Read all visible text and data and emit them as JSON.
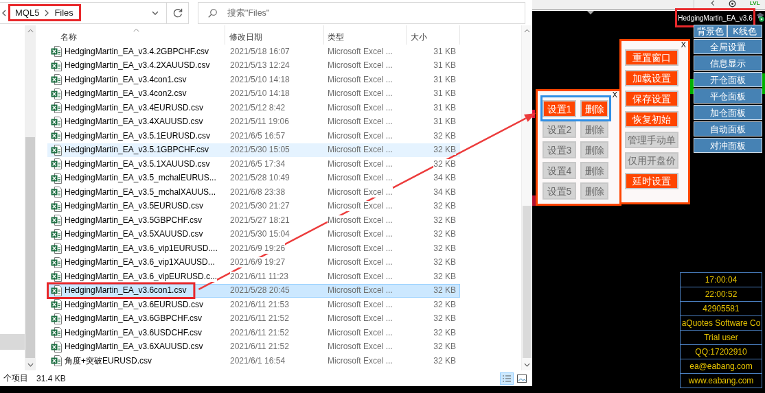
{
  "explorer": {
    "address_bar": {
      "path": [
        "MQL5",
        "Files"
      ],
      "outlined": true
    },
    "search": {
      "placeholder": "搜索\"Files\""
    },
    "columns": [
      {
        "label": "名称",
        "sorted": true
      },
      {
        "label": "修改日期",
        "sorted": false
      },
      {
        "label": "类型",
        "sorted": false
      },
      {
        "label": "大小",
        "sorted": false
      }
    ],
    "rows": [
      {
        "name": "HedgingMartin_EA_v3.4.2GBPCHF.csv",
        "modified": "2021/5/18 16:07",
        "type": "Microsoft Excel ...",
        "size": "31 KB",
        "selected": false,
        "hovered": false,
        "outlined": false
      },
      {
        "name": "HedgingMartin_EA_v3.4.2XAUUSD.csv",
        "modified": "2021/5/13 12:24",
        "type": "Microsoft Excel ...",
        "size": "31 KB",
        "selected": false,
        "hovered": false,
        "outlined": false
      },
      {
        "name": "HedgingMartin_EA_v3.4con1.csv",
        "modified": "2021/5/10 14:18",
        "type": "Microsoft Excel ...",
        "size": "31 KB",
        "selected": false,
        "hovered": false,
        "outlined": false
      },
      {
        "name": "HedgingMartin_EA_v3.4con2.csv",
        "modified": "2021/5/10 14:18",
        "type": "Microsoft Excel ...",
        "size": "31 KB",
        "selected": false,
        "hovered": false,
        "outlined": false
      },
      {
        "name": "HedgingMartin_EA_v3.4EURUSD.csv",
        "modified": "2021/5/12 8:42",
        "type": "Microsoft Excel ...",
        "size": "31 KB",
        "selected": false,
        "hovered": false,
        "outlined": false
      },
      {
        "name": "HedgingMartin_EA_v3.4XAUUSD.csv",
        "modified": "2021/5/11 19:06",
        "type": "Microsoft Excel ...",
        "size": "31 KB",
        "selected": false,
        "hovered": false,
        "outlined": false
      },
      {
        "name": "HedgingMartin_EA_v3.5.1EURUSD.csv",
        "modified": "2021/6/5 16:57",
        "type": "Microsoft Excel ...",
        "size": "32 KB",
        "selected": false,
        "hovered": false,
        "outlined": false
      },
      {
        "name": "HedgingMartin_EA_v3.5.1GBPCHF.csv",
        "modified": "2021/5/30 15:05",
        "type": "Microsoft Excel ...",
        "size": "32 KB",
        "selected": false,
        "hovered": true,
        "outlined": false
      },
      {
        "name": "HedgingMartin_EA_v3.5.1XAUUSD.csv",
        "modified": "2021/6/5 17:34",
        "type": "Microsoft Excel ...",
        "size": "32 KB",
        "selected": false,
        "hovered": false,
        "outlined": false
      },
      {
        "name": "HedgingMartin_EA_v3.5_mchalEURUS...",
        "modified": "2021/5/28 10:49",
        "type": "Microsoft Excel ...",
        "size": "34 KB",
        "selected": false,
        "hovered": false,
        "outlined": false
      },
      {
        "name": "HedgingMartin_EA_v3.5_mchalXAUUS...",
        "modified": "2021/6/8 23:38",
        "type": "Microsoft Excel ...",
        "size": "34 KB",
        "selected": false,
        "hovered": false,
        "outlined": false
      },
      {
        "name": "HedgingMartin_EA_v3.5EURUSD.csv",
        "modified": "2021/5/30 21:27",
        "type": "Microsoft Excel ...",
        "size": "32 KB",
        "selected": false,
        "hovered": false,
        "outlined": false
      },
      {
        "name": "HedgingMartin_EA_v3.5GBPCHF.csv",
        "modified": "2021/5/27 18:21",
        "type": "Microsoft Excel ...",
        "size": "32 KB",
        "selected": false,
        "hovered": false,
        "outlined": false
      },
      {
        "name": "HedgingMartin_EA_v3.5XAUUSD.csv",
        "modified": "2021/5/30 15:04",
        "type": "Microsoft Excel ...",
        "size": "32 KB",
        "selected": false,
        "hovered": false,
        "outlined": false
      },
      {
        "name": "HedgingMartin_EA_v3.6_vip1EURUSD....",
        "modified": "2021/6/9 19:26",
        "type": "Microsoft Excel ...",
        "size": "32 KB",
        "selected": false,
        "hovered": false,
        "outlined": false
      },
      {
        "name": "HedgingMartin_EA_v3.6_vip1XAUUSD...",
        "modified": "2021/6/9 19:27",
        "type": "Microsoft Excel ...",
        "size": "32 KB",
        "selected": false,
        "hovered": false,
        "outlined": false
      },
      {
        "name": "HedgingMartin_EA_v3.6_vipEURUSD.c...",
        "modified": "2021/6/11 11:23",
        "type": "Microsoft Excel ...",
        "size": "32 KB",
        "selected": false,
        "hovered": false,
        "outlined": false
      },
      {
        "name": "HedgingMartin_EA_v3.6con1.csv",
        "modified": "2021/5/28 20:45",
        "type": "Microsoft Excel ...",
        "size": "32 KB",
        "selected": true,
        "hovered": false,
        "outlined": true
      },
      {
        "name": "HedgingMartin_EA_v3.6EURUSD.csv",
        "modified": "2021/6/11 21:53",
        "type": "Microsoft Excel ...",
        "size": "32 KB",
        "selected": false,
        "hovered": false,
        "outlined": false
      },
      {
        "name": "HedgingMartin_EA_v3.6GBPCHF.csv",
        "modified": "2021/6/11 21:52",
        "type": "Microsoft Excel ...",
        "size": "32 KB",
        "selected": false,
        "hovered": false,
        "outlined": false
      },
      {
        "name": "HedgingMartin_EA_v3.6USDCHF.csv",
        "modified": "2021/6/11 21:52",
        "type": "Microsoft Excel ...",
        "size": "32 KB",
        "selected": false,
        "hovered": false,
        "outlined": false
      },
      {
        "name": "HedgingMartin_EA_v3.6XAUUSD.csv",
        "modified": "2021/6/11 21:52",
        "type": "Microsoft Excel ...",
        "size": "32 KB",
        "selected": false,
        "hovered": false,
        "outlined": false
      },
      {
        "name": "角度+突破EURUSD.csv",
        "modified": "2021/6/1 16:54",
        "type": "Microsoft Excel ...",
        "size": "32 KB",
        "selected": false,
        "hovered": false,
        "outlined": false
      }
    ],
    "status_bar": {
      "item_count": "个项目",
      "size": "31.4 KB",
      "views": [
        {
          "kind": "details",
          "selected": true
        },
        {
          "kind": "thumbnails",
          "selected": false
        }
      ]
    }
  },
  "terminal": {
    "toolbar": {
      "label": "LVL"
    },
    "ea_label": {
      "text": "HedgingMartin_EA_v3.6",
      "outlined": true
    },
    "color_buttons": [
      "背景色",
      "K线色"
    ],
    "panel_buttons": [
      "全局设置",
      "信息显示",
      "开仓面板",
      "平仓面板",
      "加仓面板",
      "自动面板",
      "对冲面板"
    ],
    "settings_menu": {
      "close": "X",
      "items": [
        {
          "label": "重置窗口",
          "disabled": false
        },
        {
          "label": "加载设置",
          "disabled": false
        },
        {
          "label": "保存设置",
          "disabled": false
        },
        {
          "label": "恢复初始",
          "disabled": false
        },
        {
          "label": "管理手动单",
          "disabled": true
        },
        {
          "label": "仅用开盘价",
          "disabled": true
        },
        {
          "label": "延时设置",
          "disabled": false
        }
      ]
    },
    "slots_panel": {
      "close": "X",
      "slots": [
        {
          "label": "设置1",
          "delete_label": "删除",
          "disabled": false,
          "outlined": true
        },
        {
          "label": "设置2",
          "delete_label": "删除",
          "disabled": true,
          "outlined": false
        },
        {
          "label": "设置3",
          "delete_label": "删除",
          "disabled": true,
          "outlined": false
        },
        {
          "label": "设置4",
          "delete_label": "删除",
          "disabled": true,
          "outlined": false
        },
        {
          "label": "设置5",
          "delete_label": "删除",
          "disabled": true,
          "outlined": false
        }
      ]
    },
    "info": [
      "17:00:04",
      "22:00:52",
      "42905581",
      "aQuotes Software Co",
      "Trial user",
      "QQ:17202910",
      "ea@eabang.com",
      "www.eabang.com"
    ]
  }
}
